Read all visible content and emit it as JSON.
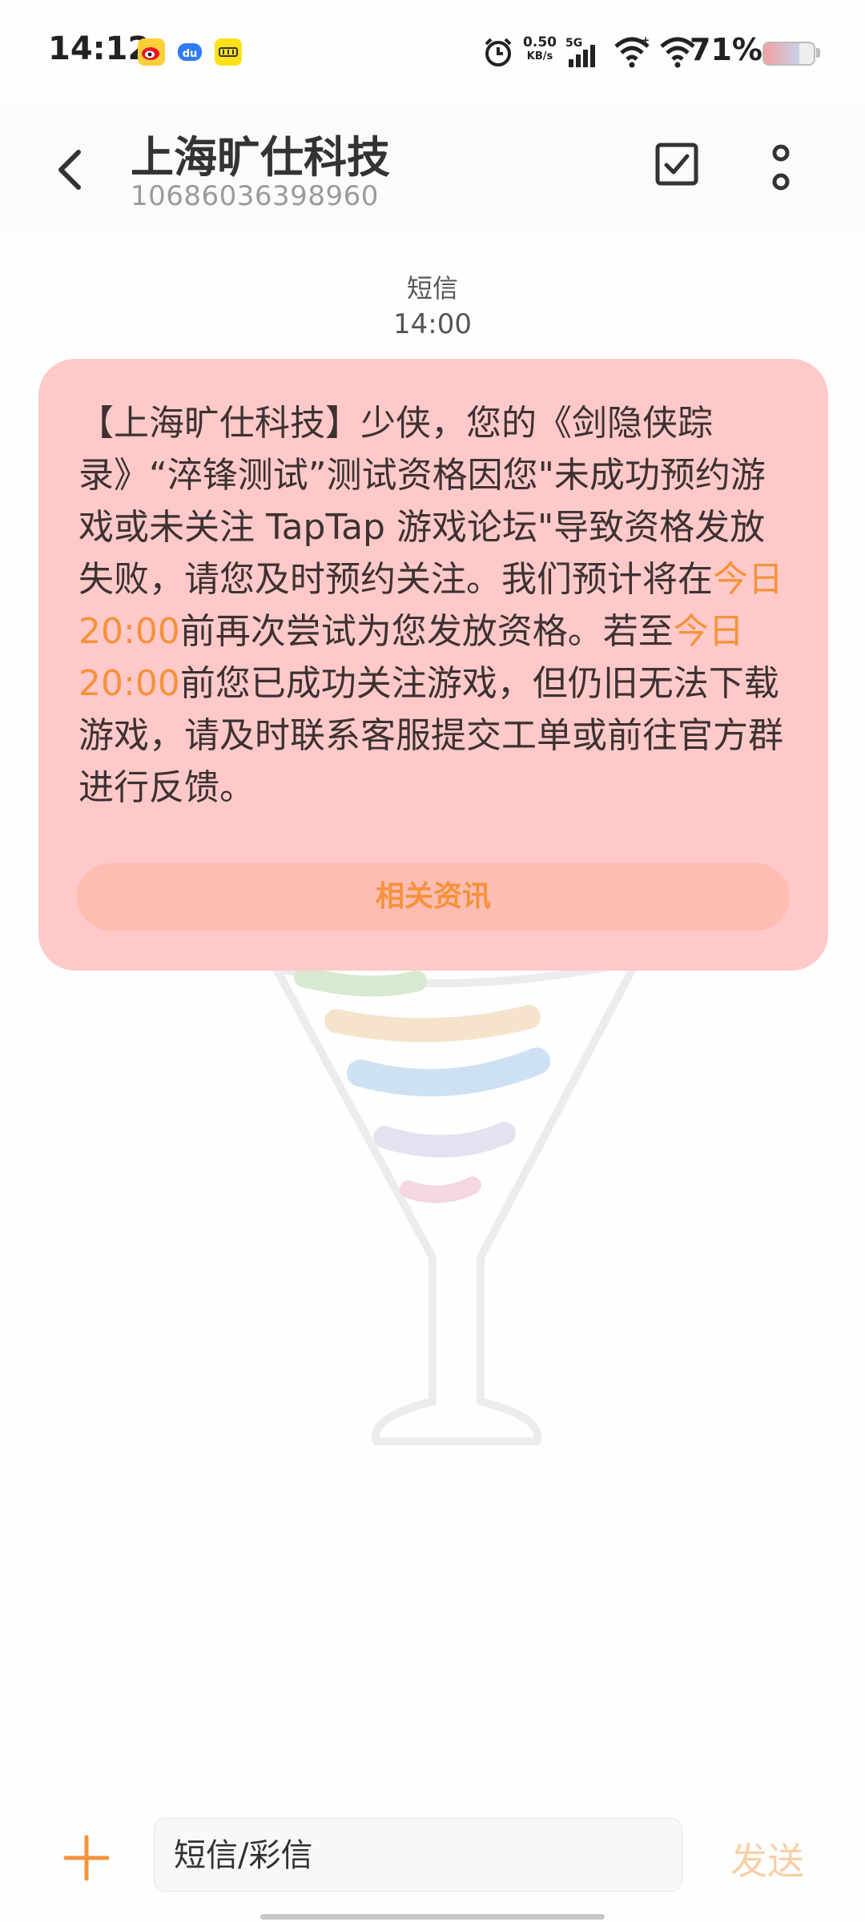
{
  "status_bar": {
    "time": "14:12",
    "net_speed_value": "0.50",
    "net_speed_unit": "KB/s",
    "network": "5G",
    "battery": "71%",
    "battery_level": 0.71,
    "notification_icons": [
      "weibo-icon",
      "du-icon",
      "meituan-icon"
    ]
  },
  "header": {
    "contact_name": "上海旷仕科技",
    "contact_number": "10686036398960"
  },
  "message": {
    "type": "短信",
    "time": "14:00",
    "text_part1": "【上海旷仕科技】少侠，您的《剑隐侠踪录》“淬锋测试”测试资格因您\"未成功预约游戏或未关注 TapTap 游戏论坛\"导致资格发放失败，请您及时预约关注。我们预计将在",
    "highlight1": "今日 20:00",
    "text_part2": "前再次尝试为您发放资格。若至",
    "highlight2": "今日 20:00",
    "text_part3": "前您已成功关注游戏，但仍旧无法下载游戏，请及时联系客服提交工单或前往官方群进行反馈。",
    "related_button": "相关资讯"
  },
  "composer": {
    "placeholder": "短信/彩信",
    "send_label": "发送"
  },
  "colors": {
    "bubble": "#ffc9c9",
    "accent": "#f5923a",
    "related_button_bg": "#ffbcb2"
  }
}
